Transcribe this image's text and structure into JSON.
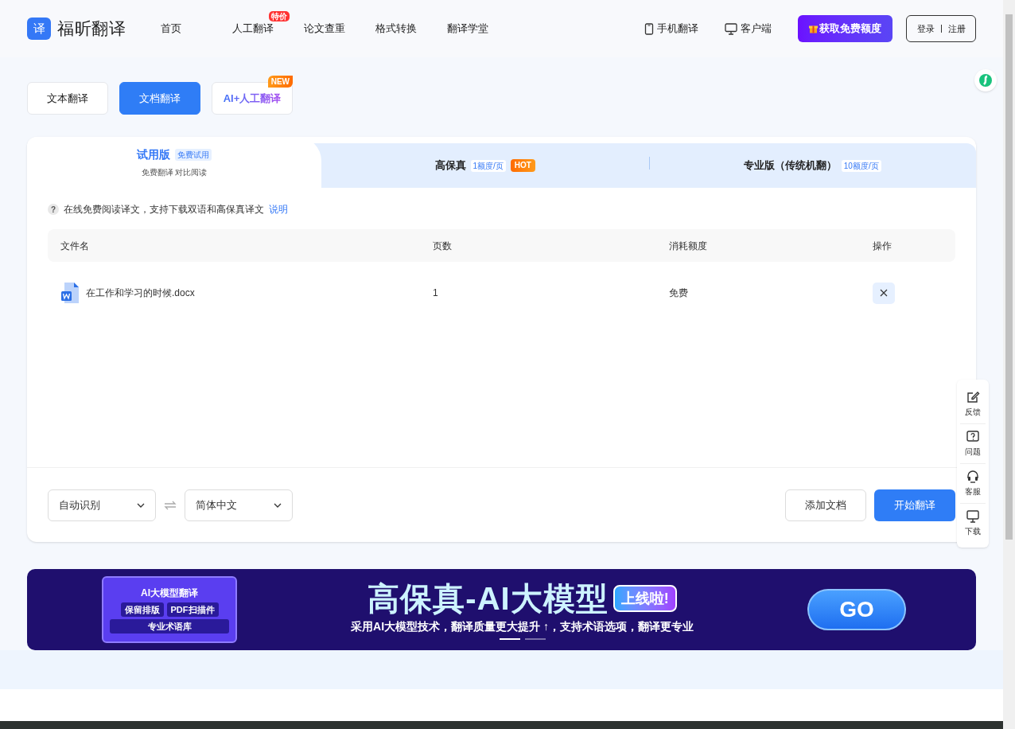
{
  "header": {
    "logo_mark": "译",
    "logo_text": "福昕翻译",
    "nav": [
      {
        "label": "首页"
      },
      {
        "label": "人工翻译",
        "badge": "特价"
      },
      {
        "label": "论文查重"
      },
      {
        "label": "格式转换"
      },
      {
        "label": "翻译学堂"
      }
    ],
    "links": [
      {
        "kind": "phone",
        "label": "手机翻译"
      },
      {
        "kind": "desktop",
        "label": "客户端"
      }
    ],
    "promo_button": "获取免费额度",
    "login": "登录",
    "register": "注册"
  },
  "mode_tabs": [
    {
      "label": "文本翻译",
      "selected": false,
      "kind": "plain"
    },
    {
      "label": "文档翻译",
      "selected": true,
      "kind": "plain"
    },
    {
      "label": "AI+人工翻译",
      "selected": false,
      "badge": "NEW",
      "kind": "gradient"
    }
  ],
  "plan_tabs": [
    {
      "title": "试用版",
      "tag": "免费试用",
      "subtitle": "免费翻译 对比阅读",
      "selected": true
    },
    {
      "title": "高保真",
      "tag": "1额度/页",
      "hot_label": "HOT",
      "selected": false
    },
    {
      "title": "专业版（传统机翻）",
      "tag": "10额度/页",
      "selected": false
    }
  ],
  "hint": {
    "icon": "?",
    "text": "在线免费阅读译文，支持下载双语和高保真译文",
    "link": "说明"
  },
  "table": {
    "columns": [
      "文件名",
      "页数",
      "消耗额度",
      "操作"
    ],
    "rows": [
      {
        "file": "在工作和学习的时候.docx",
        "pages": "1",
        "cost": "免费"
      }
    ]
  },
  "source_language": "自动识别",
  "target_language": "简体中文",
  "add_button": "添加文档",
  "start_button": "开始翻译",
  "banner": {
    "panel_title": "AI大模型翻译",
    "features": [
      "保留排版",
      "PDF扫描件",
      "专业术语库"
    ],
    "headline": "高保真-AI大模型",
    "headline_tag": "上线啦!",
    "subline": "采用AI大模型技术，翻译质量更大提升 ↑，支持术语选项，翻译更专业",
    "go": "GO",
    "dots": [
      {
        "selected": true
      },
      {
        "selected": false
      }
    ]
  },
  "side_tools": [
    {
      "kind": "edit",
      "label": "反馈"
    },
    {
      "kind": "question",
      "label": "问题"
    },
    {
      "kind": "headset",
      "label": "客服"
    },
    {
      "kind": "monitor",
      "label": "下载"
    }
  ]
}
